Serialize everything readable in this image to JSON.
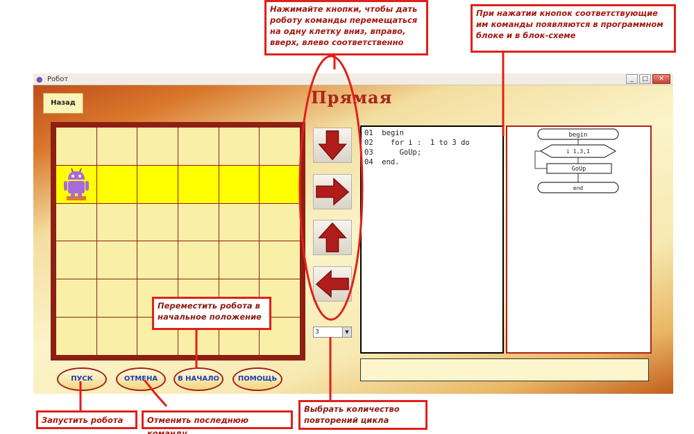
{
  "window": {
    "title": "Робот",
    "controls": [
      "_",
      "□",
      "✕"
    ]
  },
  "back_button": "Назад",
  "heading": "Прямая",
  "arrows": [
    {
      "name": "down-arrow-icon",
      "direction": "down"
    },
    {
      "name": "right-arrow-icon",
      "direction": "right"
    },
    {
      "name": "up-arrow-icon",
      "direction": "up"
    },
    {
      "name": "left-arrow-icon",
      "direction": "left"
    }
  ],
  "repeat_select": {
    "value": "3"
  },
  "code_lines": [
    "01  begin",
    "02    for i :  1 to 3 do",
    "03      GoUp;",
    "04  end."
  ],
  "flowchart": {
    "begin": "begin",
    "loop": "i  1,3,1",
    "step": "GoUp",
    "end": "end"
  },
  "grid": {
    "rows": 6,
    "cols": 6,
    "highlight_row": 1,
    "robot": {
      "row": 1,
      "col": 0
    }
  },
  "bottom_buttons": [
    {
      "id": "run",
      "label": "ПУСК"
    },
    {
      "id": "undo",
      "label": "ОТМЕНА"
    },
    {
      "id": "reset",
      "label": "В НАЧАЛО"
    },
    {
      "id": "help",
      "label": "ПОМОЩЬ"
    }
  ],
  "callouts": {
    "arrows": "Нажимайте кнопки, чтобы дать роботу команды перемещаться на одну клетку вниз, вправо, вверх, влево соответственно",
    "program": "При нажатии кнопок соответствующие им команды появляются в программном блоке и в блок-схеме",
    "reset": "Переместить робота в начальное положение",
    "run": "Запустить робота",
    "undo": "Отменить последнюю команду",
    "repeat": "Выбрать количество повторений цикла"
  },
  "colors": {
    "callout_border": "#e0201a",
    "grid_frame": "#8d1f14",
    "cell": "#f9efa7",
    "highlight": "#ffff00",
    "arrow": "#b11d1a"
  }
}
